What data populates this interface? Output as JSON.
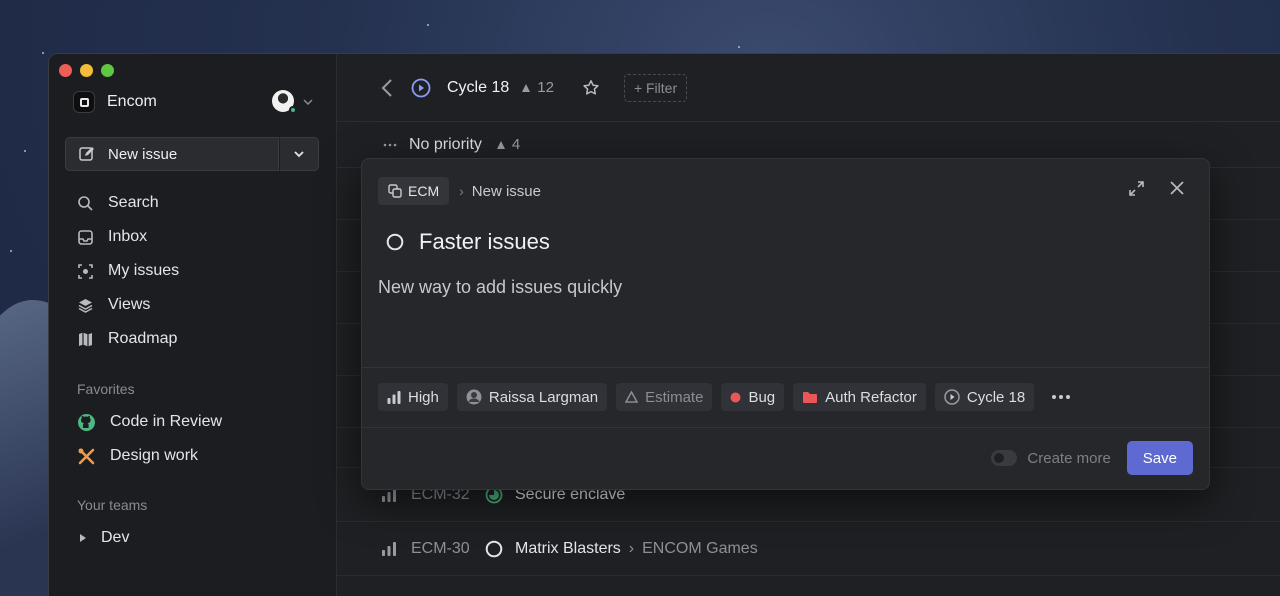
{
  "workspace": {
    "name": "Encom"
  },
  "sidebar": {
    "new_issue_label": "New issue",
    "nav": [
      {
        "label": "Search"
      },
      {
        "label": "Inbox"
      },
      {
        "label": "My issues"
      },
      {
        "label": "Views"
      },
      {
        "label": "Roadmap"
      }
    ],
    "favorites_label": "Favorites",
    "favorites": [
      {
        "label": "Code in Review"
      },
      {
        "label": "Design work"
      }
    ],
    "teams_label": "Your teams",
    "teams": [
      {
        "label": "Dev"
      }
    ]
  },
  "header": {
    "title": "Cycle 18",
    "count": "12",
    "filter_label": "+ Filter"
  },
  "list": {
    "group_label": "No priority",
    "group_count": "4",
    "issues": [
      {
        "id": "ECM-32",
        "title": "Secure enclave",
        "project": ""
      },
      {
        "id": "ECM-30",
        "title": "Matrix Blasters",
        "project": "ENCOM Games"
      }
    ]
  },
  "modal": {
    "team": "ECM",
    "breadcrumb": "New issue",
    "title": "Faster issues",
    "description": "New way to add issues quickly",
    "chips": {
      "priority": "High",
      "assignee": "Raissa Largman",
      "estimate": "Estimate",
      "label": "Bug",
      "project": "Auth Refactor",
      "cycle": "Cycle 18"
    },
    "create_more_label": "Create more",
    "save_label": "Save"
  },
  "colors": {
    "accent": "#5e6ad2",
    "bug": "#eb5757",
    "project_folder": "#eb5757",
    "online": "#4cb782",
    "in_progress": "#4cb782",
    "cycle": "#8b9cf7"
  }
}
